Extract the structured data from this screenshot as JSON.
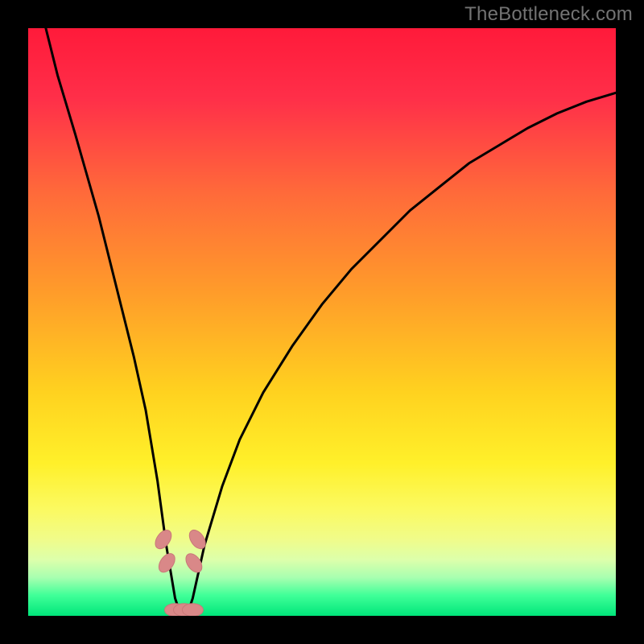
{
  "watermark": "TheBottleneck.com",
  "colors": {
    "frame": "#000000",
    "gradient_stops": [
      {
        "offset": 0.0,
        "color": "#ff1a3a"
      },
      {
        "offset": 0.12,
        "color": "#ff2f49"
      },
      {
        "offset": 0.28,
        "color": "#ff6a3a"
      },
      {
        "offset": 0.45,
        "color": "#ff9c2a"
      },
      {
        "offset": 0.62,
        "color": "#ffd21f"
      },
      {
        "offset": 0.74,
        "color": "#fff02a"
      },
      {
        "offset": 0.82,
        "color": "#fbfa62"
      },
      {
        "offset": 0.87,
        "color": "#f0fc8a"
      },
      {
        "offset": 0.905,
        "color": "#dcffab"
      },
      {
        "offset": 0.935,
        "color": "#a8ffb0"
      },
      {
        "offset": 0.965,
        "color": "#40ff98"
      },
      {
        "offset": 1.0,
        "color": "#00e67a"
      }
    ],
    "curve": "#000000",
    "marker_fill": "#d98888",
    "marker_stroke": "#c97878"
  },
  "chart_data": {
    "type": "line",
    "title": "",
    "xlabel": "",
    "ylabel": "",
    "xlim": [
      0,
      100
    ],
    "ylim": [
      0,
      100
    ],
    "legend": false,
    "grid": false,
    "series": [
      {
        "name": "bottleneck-curve",
        "x": [
          3,
          5,
          8,
          10,
          12,
          14,
          16,
          18,
          20,
          22,
          23.5,
          25,
          26,
          27,
          28,
          30,
          33,
          36,
          40,
          45,
          50,
          55,
          60,
          65,
          70,
          75,
          80,
          85,
          90,
          95,
          100
        ],
        "values": [
          100,
          92,
          82,
          75,
          68,
          60,
          52,
          44,
          35,
          23,
          12,
          3,
          0,
          0,
          3,
          12,
          22,
          30,
          38,
          46,
          53,
          59,
          64,
          69,
          73,
          77,
          80,
          83,
          85.5,
          87.5,
          89
        ]
      }
    ],
    "markers": [
      {
        "x": 23.0,
        "y": 13
      },
      {
        "x": 23.6,
        "y": 9
      },
      {
        "x": 28.2,
        "y": 9
      },
      {
        "x": 28.8,
        "y": 13
      },
      {
        "x": 25.0,
        "y": 1
      },
      {
        "x": 26.5,
        "y": 1
      },
      {
        "x": 28.0,
        "y": 1
      }
    ]
  }
}
